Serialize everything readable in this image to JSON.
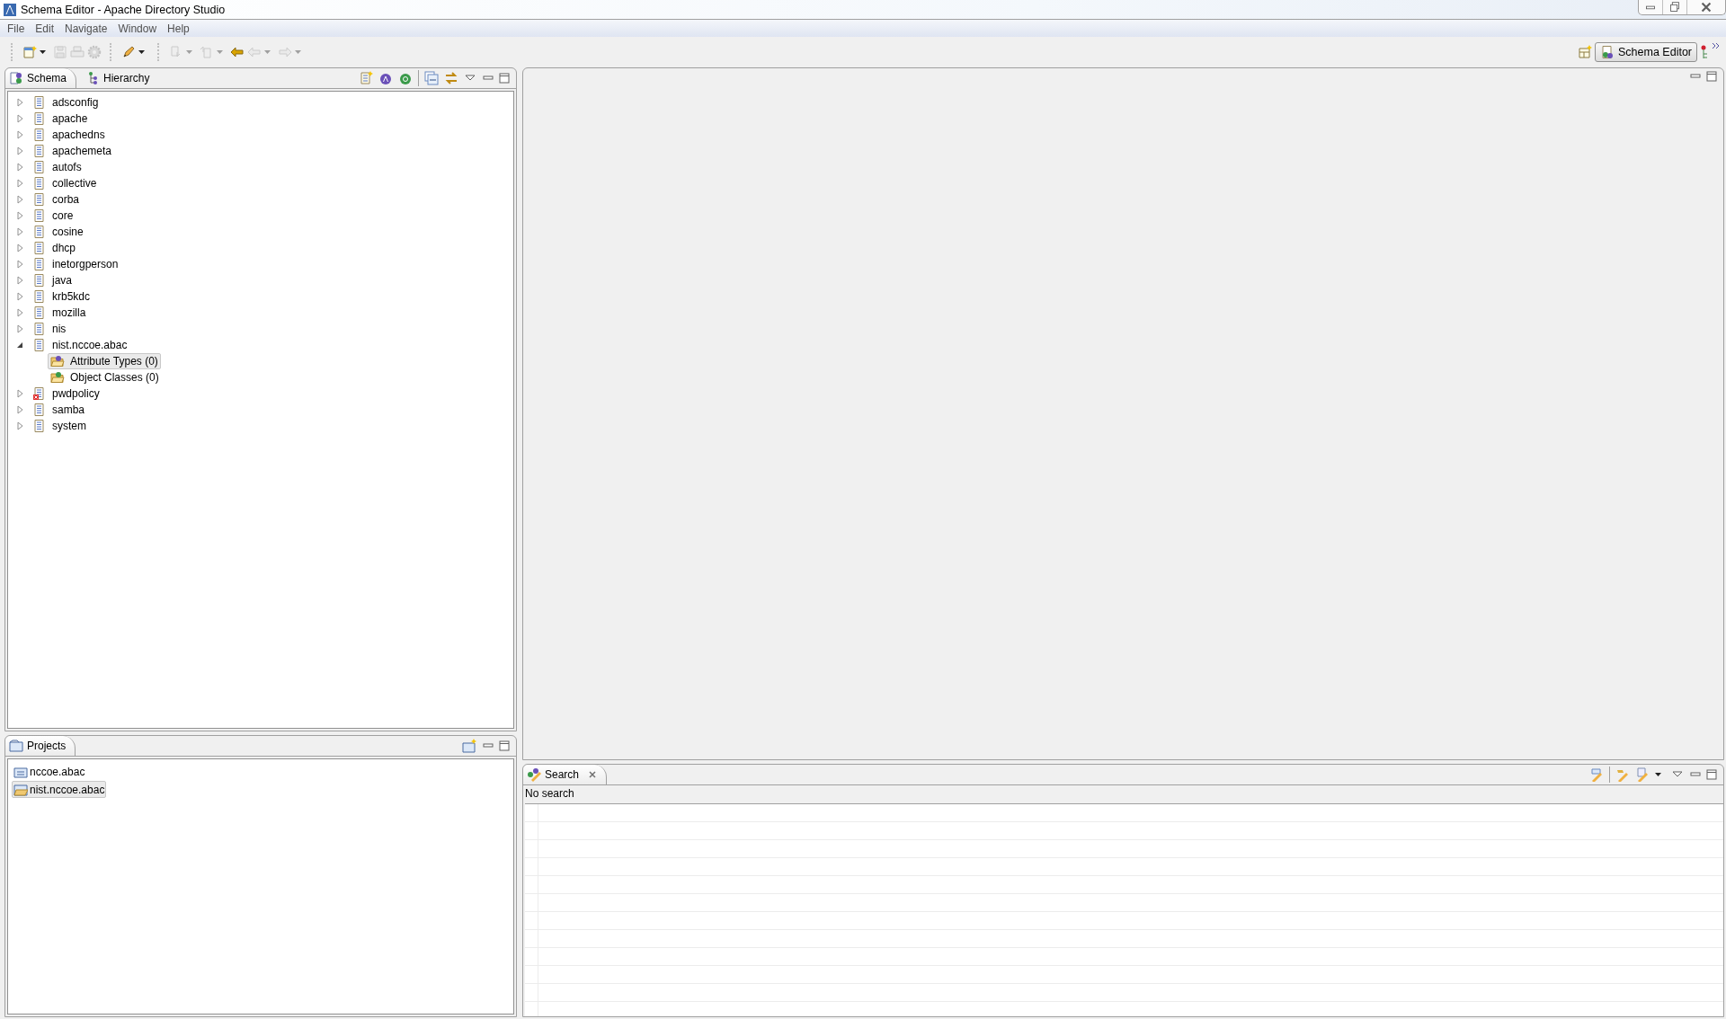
{
  "window": {
    "title": "Schema Editor - Apache Directory Studio"
  },
  "menu": [
    "File",
    "Edit",
    "Navigate",
    "Window",
    "Help"
  ],
  "perspective": {
    "label": "Schema Editor",
    "selected": true
  },
  "schema_view": {
    "tabs": [
      {
        "label": "Schema",
        "selected": true
      },
      {
        "label": "Hierarchy",
        "selected": false
      }
    ],
    "tree": [
      {
        "label": "adsconfig",
        "kind": "schema",
        "expanded": false,
        "selected": false
      },
      {
        "label": "apache",
        "kind": "schema",
        "expanded": false,
        "selected": false
      },
      {
        "label": "apachedns",
        "kind": "schema",
        "expanded": false,
        "selected": false
      },
      {
        "label": "apachemeta",
        "kind": "schema",
        "expanded": false,
        "selected": false
      },
      {
        "label": "autofs",
        "kind": "schema",
        "expanded": false,
        "selected": false
      },
      {
        "label": "collective",
        "kind": "schema",
        "expanded": false,
        "selected": false
      },
      {
        "label": "corba",
        "kind": "schema",
        "expanded": false,
        "selected": false
      },
      {
        "label": "core",
        "kind": "schema",
        "expanded": false,
        "selected": false
      },
      {
        "label": "cosine",
        "kind": "schema",
        "expanded": false,
        "selected": false
      },
      {
        "label": "dhcp",
        "kind": "schema",
        "expanded": false,
        "selected": false
      },
      {
        "label": "inetorgperson",
        "kind": "schema",
        "expanded": false,
        "selected": false
      },
      {
        "label": "java",
        "kind": "schema",
        "expanded": false,
        "selected": false
      },
      {
        "label": "krb5kdc",
        "kind": "schema",
        "expanded": false,
        "selected": false
      },
      {
        "label": "mozilla",
        "kind": "schema",
        "expanded": false,
        "selected": false
      },
      {
        "label": "nis",
        "kind": "schema",
        "expanded": false,
        "selected": false
      },
      {
        "label": "nist.nccoe.abac",
        "kind": "schema",
        "expanded": true,
        "selected": false,
        "children": [
          {
            "label": "Attribute Types (0)",
            "kind": "attribute-folder",
            "selected": true
          },
          {
            "label": "Object Classes (0)",
            "kind": "class-folder",
            "selected": false
          }
        ]
      },
      {
        "label": "pwdpolicy",
        "kind": "schema-error",
        "expanded": false,
        "selected": false
      },
      {
        "label": "samba",
        "kind": "schema",
        "expanded": false,
        "selected": false
      },
      {
        "label": "system",
        "kind": "schema",
        "expanded": false,
        "selected": false
      }
    ]
  },
  "projects_view": {
    "tab": {
      "label": "Projects",
      "selected": true
    },
    "items": [
      {
        "label": "nccoe.abac",
        "open": false,
        "selected": false
      },
      {
        "label": "nist.nccoe.abac",
        "open": true,
        "selected": true
      }
    ]
  },
  "search_view": {
    "tab": {
      "label": "Search",
      "selected": true
    },
    "status": "No search"
  }
}
